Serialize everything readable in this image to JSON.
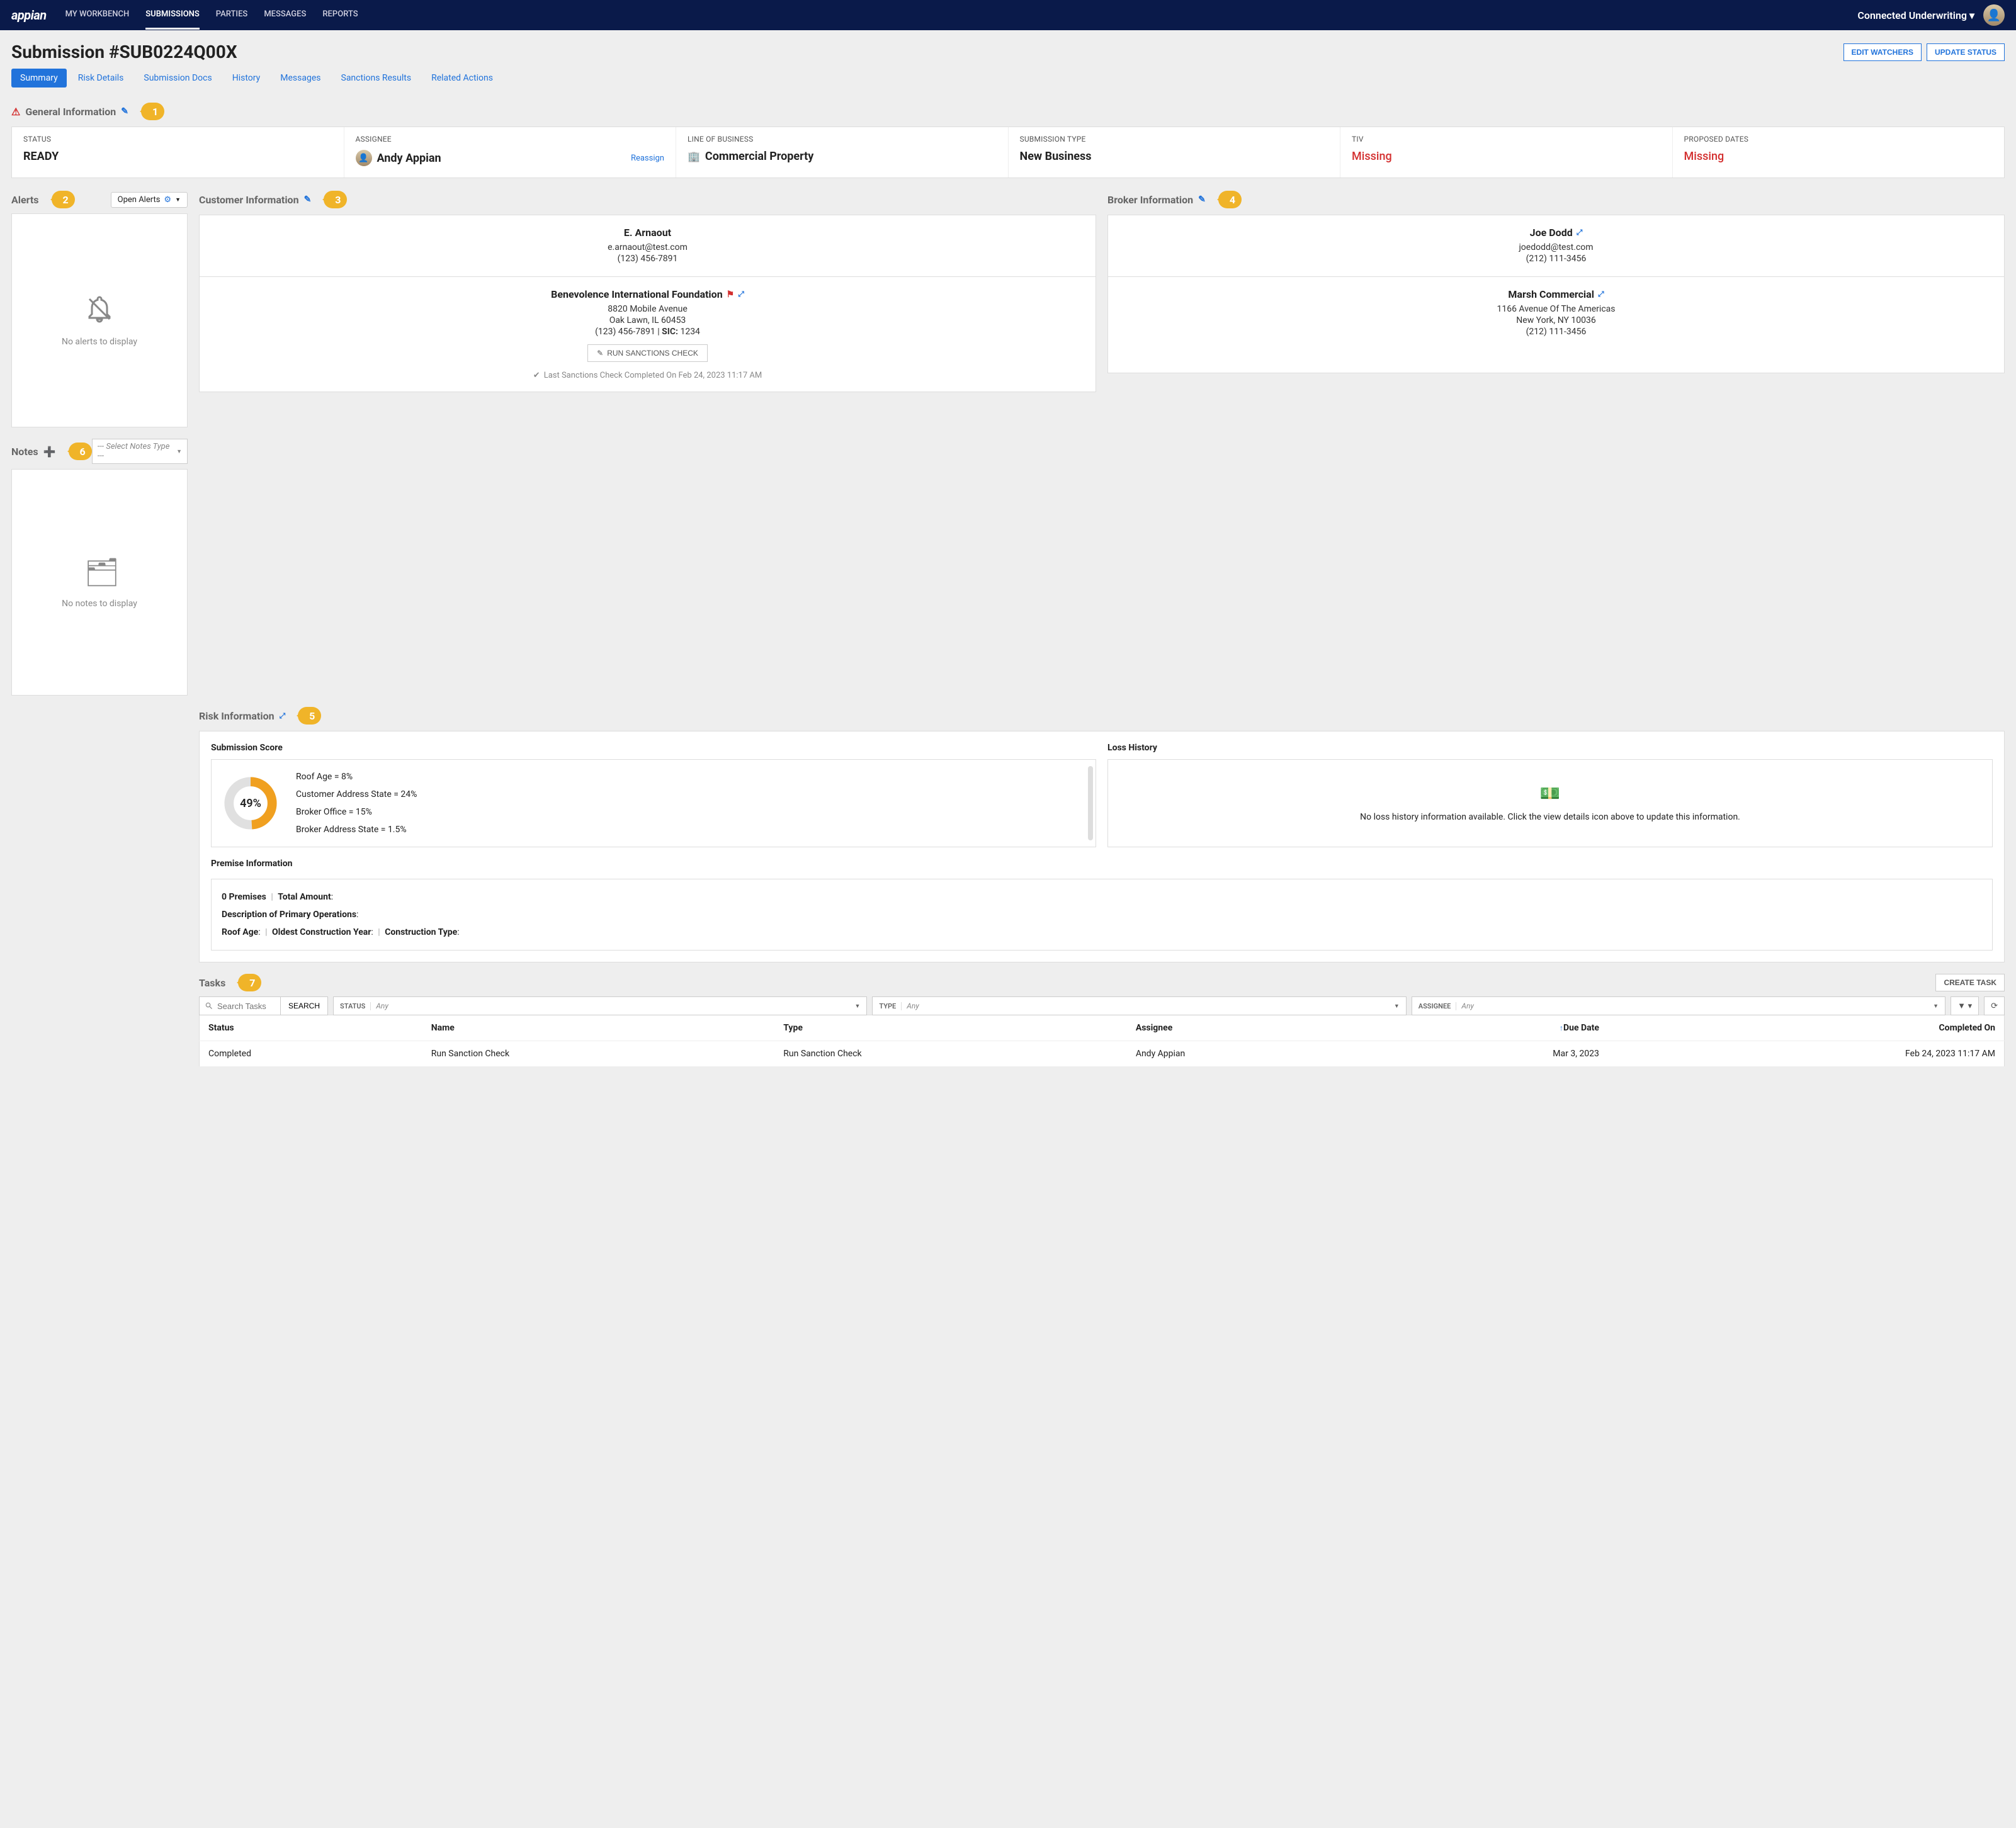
{
  "nav": {
    "logo": "appian",
    "items": [
      "MY WORKBENCH",
      "SUBMISSIONS",
      "PARTIES",
      "MESSAGES",
      "REPORTS"
    ],
    "active": "SUBMISSIONS",
    "workspace": "Connected Underwriting"
  },
  "page": {
    "title": "Submission #SUB0224Q00X",
    "edit_watchers": "EDIT WATCHERS",
    "update_status": "UPDATE STATUS"
  },
  "tabs": {
    "items": [
      "Summary",
      "Risk Details",
      "Submission Docs",
      "History",
      "Messages",
      "Sanctions Results",
      "Related Actions"
    ],
    "active": "Summary"
  },
  "callouts": {
    "c1": "1",
    "c2": "2",
    "c3": "3",
    "c4": "4",
    "c5": "5",
    "c6": "6",
    "c7": "7"
  },
  "general": {
    "title": "General Information",
    "status_label": "STATUS",
    "status_value": "READY",
    "assignee_label": "ASSIGNEE",
    "assignee_value": "Andy Appian",
    "reassign": "Reassign",
    "lob_label": "LINE OF BUSINESS",
    "lob_value": "Commercial Property",
    "subtype_label": "SUBMISSION TYPE",
    "subtype_value": "New Business",
    "tiv_label": "TIV",
    "tiv_value": "Missing",
    "dates_label": "PROPOSED DATES",
    "dates_value": "Missing"
  },
  "alerts": {
    "title": "Alerts",
    "dropdown": "Open Alerts",
    "empty": "No alerts to display"
  },
  "notes": {
    "title": "Notes",
    "select_placeholder": "--- Select Notes Type ---",
    "empty": "No notes to display"
  },
  "customer": {
    "title": "Customer Information",
    "name": "E. Arnaout",
    "email": "e.arnaout@test.com",
    "phone": "(123) 456-7891",
    "org": "Benevolence International Foundation",
    "addr1": "8820 Mobile Avenue",
    "addr2": "Oak Lawn, IL 60453",
    "phone2": "(123) 456-7891",
    "sic_label": "SIC:",
    "sic": "1234",
    "run_sanctions": "RUN SANCTIONS CHECK",
    "last_check": "Last Sanctions Check Completed On Feb 24, 2023 11:17 AM"
  },
  "broker": {
    "title": "Broker Information",
    "name": "Joe Dodd",
    "email": "joedodd@test.com",
    "phone": "(212) 111-3456",
    "org": "Marsh Commercial",
    "addr1": "1166 Avenue Of The Americas",
    "addr2": "New York, NY 10036",
    "phone2": "(212) 111-3456"
  },
  "risk": {
    "title": "Risk Information",
    "score_title": "Submission Score",
    "score_pct": "49%",
    "lines": [
      "Roof Age = 8%",
      "Customer Address State = 24%",
      "Broker Office = 15%",
      "Broker Address State = 1.5%"
    ],
    "loss_title": "Loss History",
    "loss_empty": "No loss history information available. Click the view details icon above to update this information.",
    "premise_title": "Premise Information",
    "premise_count_label": "0 Premises",
    "total_amount_label": "Total Amount",
    "desc_label": "Description of Primary Operations",
    "roof_label": "Roof Age",
    "oldest_label": "Oldest Construction Year",
    "ctype_label": "Construction Type",
    "colon": ":",
    "sep": "|"
  },
  "tasks": {
    "title": "Tasks",
    "create": "CREATE TASK",
    "search_placeholder": "Search Tasks",
    "search_btn": "SEARCH",
    "status_label": "STATUS",
    "type_label": "TYPE",
    "assignee_label": "ASSIGNEE",
    "any": "Any",
    "cols": {
      "status": "Status",
      "name": "Name",
      "type": "Type",
      "assignee": "Assignee",
      "due": "Due Date",
      "completed": "Completed On"
    },
    "rows": [
      {
        "status": "Completed",
        "name": "Run Sanction Check",
        "type": "Run Sanction Check",
        "assignee": "Andy Appian",
        "due": "Mar 3, 2023",
        "completed": "Feb 24, 2023 11:17 AM"
      }
    ]
  },
  "chart_data": {
    "type": "pie",
    "title": "Submission Score",
    "center_label": "49%",
    "values": [
      49,
      51
    ],
    "colors": [
      "#f0a020",
      "#e0e0e0"
    ],
    "breakdown": [
      {
        "label": "Roof Age",
        "value": 8
      },
      {
        "label": "Customer Address State",
        "value": 24
      },
      {
        "label": "Broker Office",
        "value": 15
      },
      {
        "label": "Broker Address State",
        "value": 1.5
      }
    ]
  }
}
